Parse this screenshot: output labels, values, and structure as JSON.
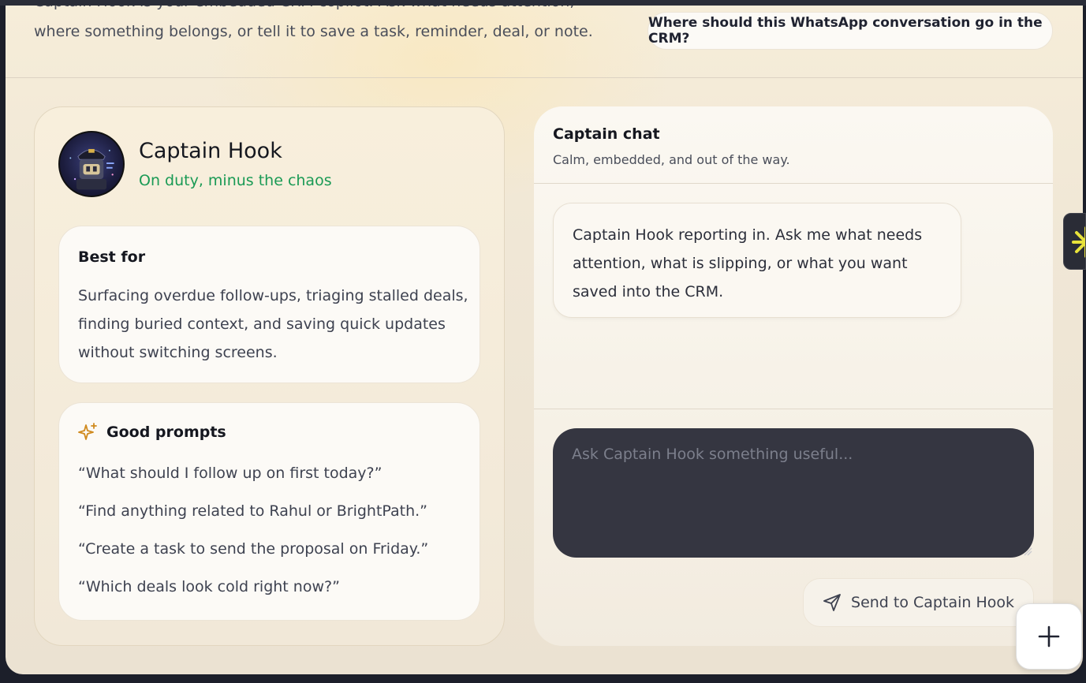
{
  "header": {
    "intro_line1": "Captain Hook is your embedded CRM copilot. Ask what needs attention,",
    "intro_line2": "where something belongs, or tell it to save a task, reminder, deal, or note.",
    "suggestion": "Where should this WhatsApp conversation go in the CRM?"
  },
  "profile": {
    "name": "Captain Hook",
    "status": "On duty, minus the chaos",
    "avatar_icon": "robot-captain-avatar",
    "status_color": "#1a9a55"
  },
  "best_for": {
    "title": "Best for",
    "body": "Surfacing overdue follow-ups, triaging stalled deals, finding buried context, and saving quick updates without switching screens."
  },
  "prompts": {
    "title": "Good prompts",
    "icon": "sparkle-icon",
    "items": [
      "“What should I follow up on first today?”",
      "“Find anything related to Rahul or BrightPath.”",
      "“Create a task to send the proposal on Friday.”",
      "“Which deals look cold right now?”"
    ]
  },
  "chat": {
    "title": "Captain chat",
    "subtitle": "Calm, embedded, and out of the way.",
    "messages": [
      {
        "role": "assistant",
        "text": "Captain Hook reporting in. Ask me what needs attention, what is slipping, or what you want saved into the CRM."
      }
    ],
    "composer_placeholder": "Ask Captain Hook something useful...",
    "send_label": "Send to Captain Hook",
    "send_icon": "send-icon"
  },
  "floating": {
    "fab_icon": "plus-icon",
    "side_tab_icon": "asterisk-icon",
    "side_tab_color": "#e8e23a"
  }
}
